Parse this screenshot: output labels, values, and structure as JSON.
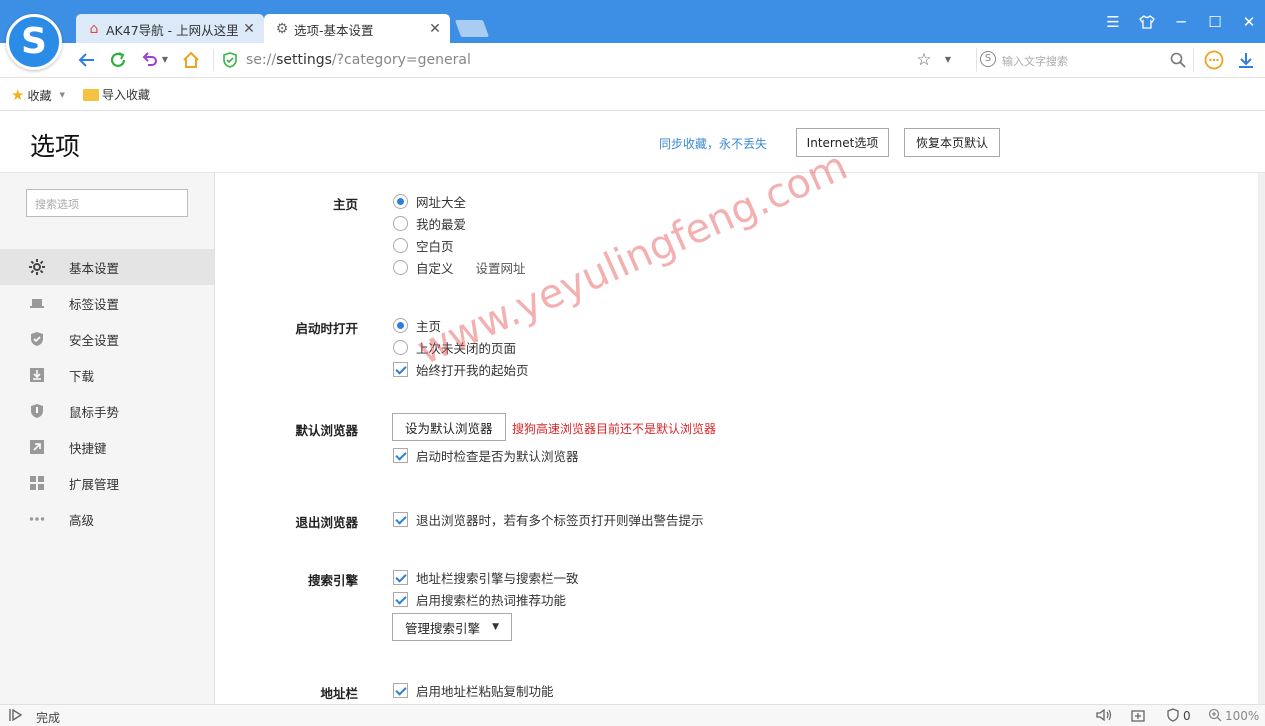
{
  "browser": {
    "logo_letter": "S",
    "tabs": [
      {
        "icon": "home-icon",
        "title": "AK47导航 - 上网从这里"
      },
      {
        "icon": "gear-icon",
        "title": "选项-基本设置"
      }
    ],
    "close_glyph": "✕",
    "url_scheme": "se://",
    "url_host": "settings",
    "url_path": "/?category=general",
    "search_placeholder": "输入文字搜索",
    "search_engine_letter": "S",
    "accent_color": "#3d8fe6"
  },
  "bookmarks": {
    "favorites_label": "收藏",
    "import_label": "导入收藏"
  },
  "header": {
    "title": "选项",
    "sync_link": "同步收藏，永不丢失",
    "internet_options": "Internet选项",
    "restore_default": "恢复本页默认"
  },
  "sidebar": {
    "search_placeholder": "搜索选项",
    "items": [
      {
        "label": "基本设置",
        "icon": "gear-icon"
      },
      {
        "label": "标签设置",
        "icon": "laptop-icon"
      },
      {
        "label": "安全设置",
        "icon": "shield-check-icon"
      },
      {
        "label": "下载",
        "icon": "download-icon"
      },
      {
        "label": "鼠标手势",
        "icon": "mouse-shield-icon"
      },
      {
        "label": "快捷键",
        "icon": "arrow-icon"
      },
      {
        "label": "扩展管理",
        "icon": "grid-icon"
      },
      {
        "label": "高级",
        "icon": "more-icon"
      }
    ]
  },
  "sections": {
    "homepage": {
      "label": "主页",
      "options": [
        "网址大全",
        "我的最爱",
        "空白页",
        "自定义"
      ],
      "selected_index": 0,
      "set_url_link": "设置网址"
    },
    "startup": {
      "label": "启动时打开",
      "radio_options": [
        "主页",
        "上次未关闭的页面"
      ],
      "selected_index": 0,
      "checkbox": "始终打开我的起始页",
      "checkbox_checked": true
    },
    "default_browser": {
      "label": "默认浏览器",
      "button": "设为默认浏览器",
      "warning": "搜狗高速浏览器目前还不是默认浏览器",
      "checkbox": "启动时检查是否为默认浏览器",
      "checkbox_checked": true
    },
    "exit": {
      "label": "退出浏览器",
      "checkbox": "退出浏览器时，若有多个标签页打开则弹出警告提示",
      "checkbox_checked": true
    },
    "search_engine": {
      "label": "搜索引擎",
      "checkboxes": [
        "地址栏搜索引擎与搜索栏一致",
        "启用搜索栏的热词推荐功能"
      ],
      "manage_button": "管理搜索引擎"
    },
    "address_bar": {
      "label": "地址栏",
      "checkbox": "启用地址栏粘贴复制功能"
    }
  },
  "watermark": "www.yeyulingfeng.com",
  "status": {
    "text": "完成",
    "ad_count": "0",
    "zoom": "100%"
  }
}
